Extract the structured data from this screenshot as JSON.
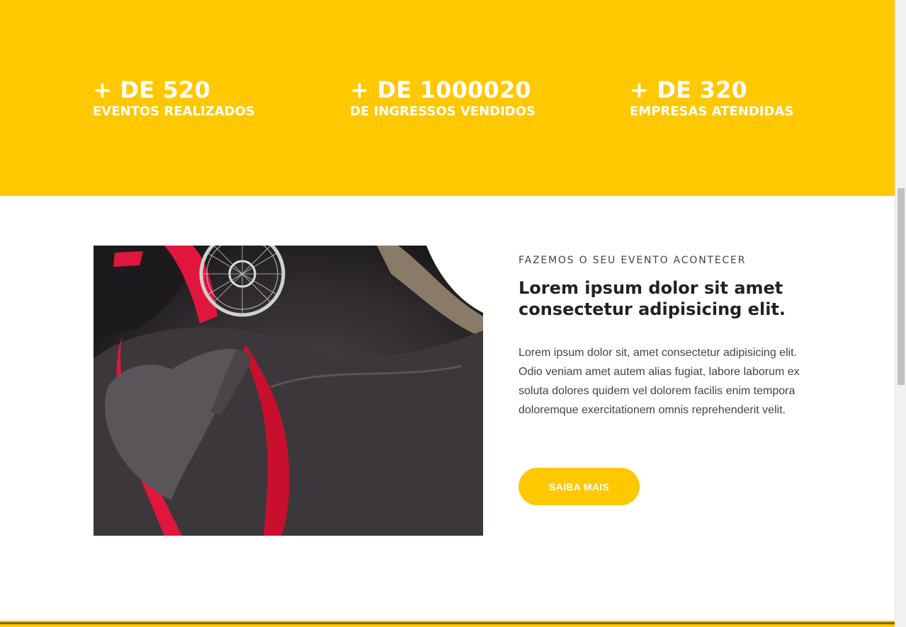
{
  "stats": [
    {
      "number": "+ DE 520",
      "label": "EVENTOS REALIZADOS"
    },
    {
      "number": "+ DE 1000020",
      "label": "DE INGRESSOS VENDIDOS"
    },
    {
      "number": "+ DE 320",
      "label": "EMPRESAS ATENDIDAS"
    }
  ],
  "about": {
    "eyebrow": "FAZEMOS O SEU EVENTO ACONTECER",
    "headline": "Lorem ipsum dolor sit amet consectetur adipisicing elit.",
    "body": "Lorem ipsum dolor sit, amet consectetur adipisicing elit. Odio veniam amet autem alias fugiat, labore laborum ex soluta dolores quidem vel dolorem facilis enim tempora doloremque exercitationem omnis reprehenderit velit.",
    "cta_label": "SAIBA MAIS",
    "image_icon": "photo-body-paint"
  },
  "colors": {
    "accent": "#FFC800",
    "heading": "#222222",
    "text": "#444444",
    "white": "#FFFFFF"
  }
}
